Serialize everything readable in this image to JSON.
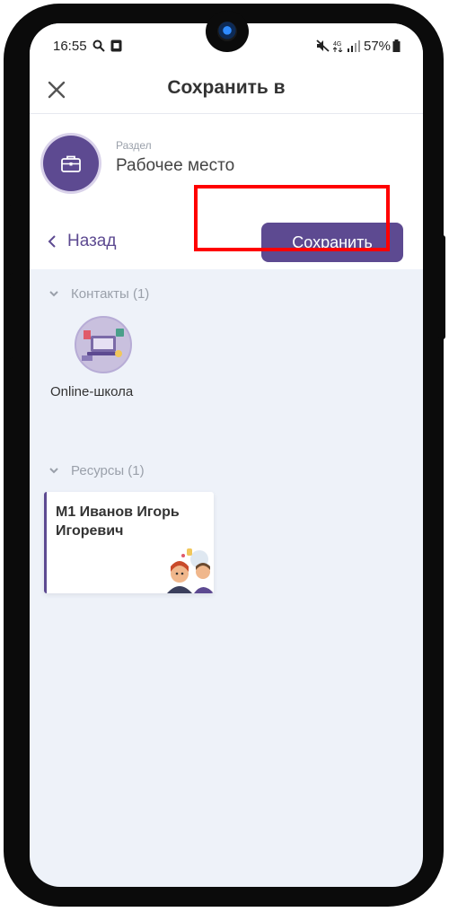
{
  "status_bar": {
    "time": "16:55",
    "network": "4G",
    "battery": "57%"
  },
  "header": {
    "title": "Сохранить в"
  },
  "section": {
    "caption": "Раздел",
    "name": "Рабочее место"
  },
  "actions": {
    "back_label": "Назад",
    "save_label": "Сохранить"
  },
  "groups": {
    "contacts": {
      "label": "Контакты (1)",
      "items": [
        {
          "name": "Online-школа"
        }
      ]
    },
    "resources": {
      "label": "Ресурсы (1)",
      "items": [
        {
          "title": "М1 Иванов Игорь Игоревич"
        }
      ]
    }
  },
  "colors": {
    "accent": "#5d4a91",
    "highlight": "#ff0000",
    "background": "#eef2f9"
  }
}
